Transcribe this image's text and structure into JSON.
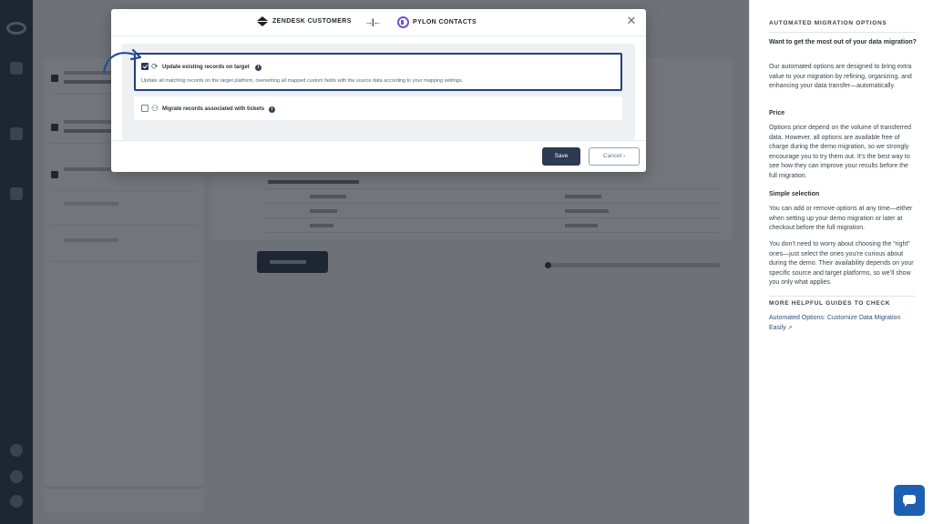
{
  "modal": {
    "source_brand": "ZENDESK CUSTOMERS",
    "target_brand": "PYLON CONTACTS",
    "close_icon": "close-icon",
    "options": [
      {
        "title": "Update existing records on target",
        "checked": true,
        "icon": "sync-icon",
        "description": "Update all matching records on the target platform, overwriting all mapped custom fields with the source data according to your mapping settings."
      },
      {
        "title": "Migrate records associated with tickets",
        "checked": false,
        "icon": "related-records-icon",
        "description": ""
      }
    ],
    "save_label": "Save",
    "cancel_label": "Cancel"
  },
  "panel": {
    "heading": "AUTOMATED MIGRATION OPTIONS",
    "question": "Want to get the most out of your data migration?",
    "intro": "Our automated options are designed to bring extra value to your migration by refining, organizing, and enhancing your data transfer—automatically.",
    "price_heading": "Price",
    "price_text": "Options price depend on the volume of transferred data. However, all options are available free of charge during the demo migration, so we strongly encourage you to try them out. It’s the best way to see how they can improve your results before the full migration.",
    "selection_heading": "Simple selection",
    "selection_text": "You can add or remove options at any time—either when setting up your demo migration or later at checkout before the full migration.",
    "worry_text": "You don’t need to worry about choosing the “right” ones—just select the ones you’re curious about during the demo. Their availability depends on your specific source and target platforms, so we’ll show you only what applies.",
    "guides_heading": "MORE HELPFUL GUIDES TO CHECK",
    "guide_link": "Automated Options: Customize Data Migration Easily"
  },
  "colors": {
    "navy": "#233146",
    "accent_border": "#23407a",
    "chat": "#1e5fb4",
    "pylon": "#6d56c9"
  }
}
